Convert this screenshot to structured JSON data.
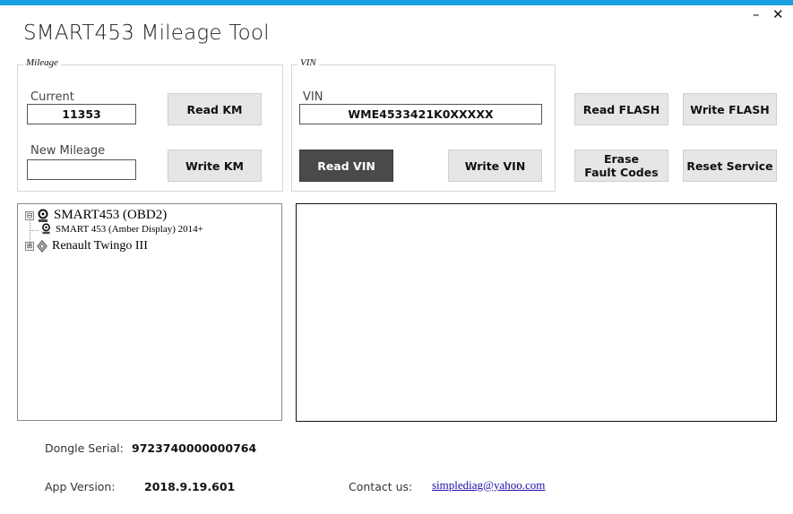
{
  "window": {
    "title": "SMART453 Mileage Tool",
    "minimize_glyph": "–",
    "close_glyph": "✕",
    "accent_color": "#1ba1e2"
  },
  "mileage": {
    "legend": "Mileage",
    "current_label": "Current",
    "current_value": "11353",
    "new_label": "New Mileage",
    "new_value": "",
    "read_button": "Read KM",
    "write_button": "Write KM"
  },
  "vin": {
    "legend": "VIN",
    "vin_label": "VIN",
    "vin_value": "WME4533421K0XXXXX",
    "read_button": "Read VIN",
    "write_button": "Write VIN"
  },
  "actions": {
    "read_flash": "Read FLASH",
    "write_flash": "Write FLASH",
    "erase_line1": "Erase",
    "erase_line2": "Fault Codes",
    "reset_service": "Reset Service"
  },
  "tree": {
    "nodes": [
      {
        "label": "SMART453 (OBD2)",
        "expander": "⊟",
        "icon": "smart-car-icon"
      },
      {
        "label": "SMART 453 (Amber Display) 2014+",
        "icon": "smart-car-icon"
      },
      {
        "label": "Renault Twingo III",
        "expander": "⊞",
        "icon": "renault-logo-icon"
      }
    ]
  },
  "footer": {
    "dongle_label": "Dongle Serial:",
    "dongle_value": "9723740000000764",
    "version_label": "App Version:",
    "version_value": "2018.9.19.601",
    "contact_label": "Contact us:",
    "contact_email": "simplediag@yahoo.com"
  }
}
